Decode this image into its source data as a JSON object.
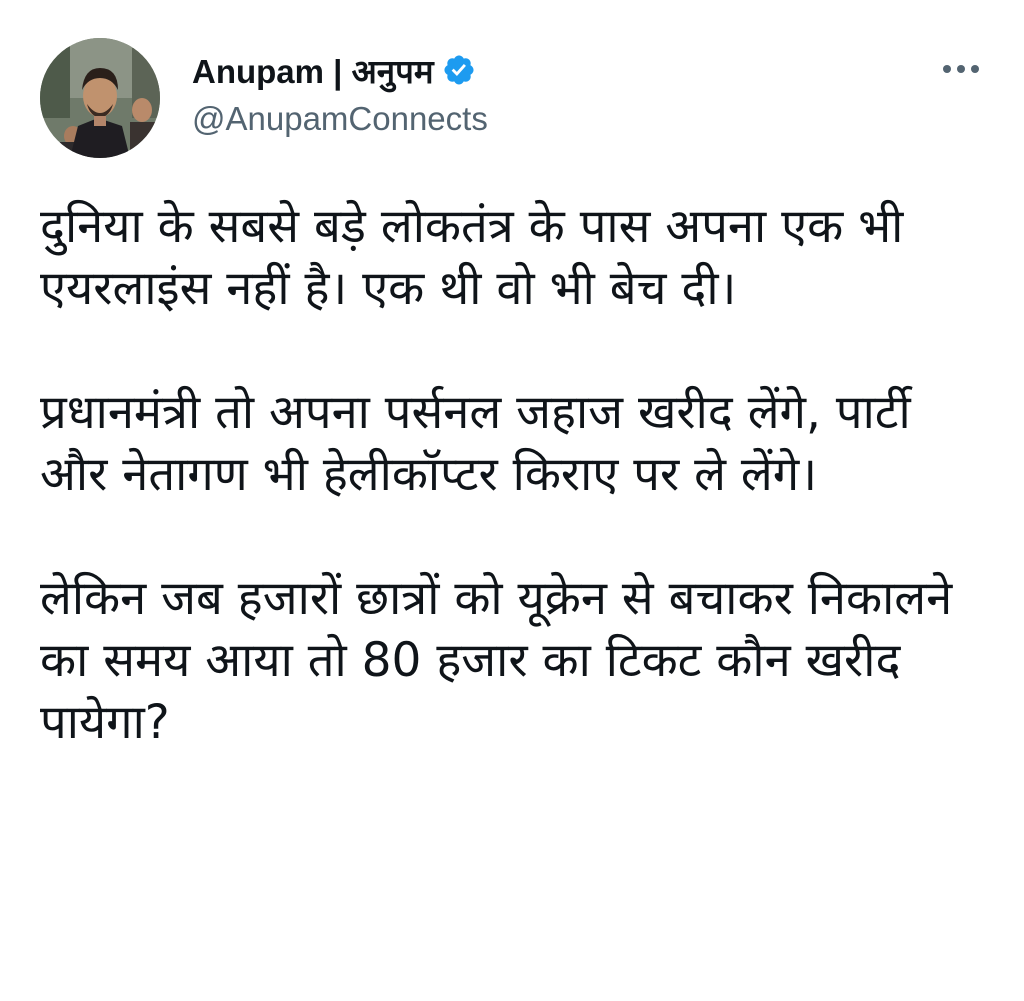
{
  "author": {
    "display_name": "Anupam | अनुपम",
    "handle": "@AnupamConnects",
    "verified": true,
    "avatar_icon": "profile-photo"
  },
  "more_icon": "more-options-icon",
  "tweet": {
    "paragraphs": [
      "दुनिया के सबसे बड़े लोकतंत्र के पास अपना एक भी एयरलाइंस नहीं है। एक थी वो भी बेच दी।",
      "प्रधानमंत्री तो अपना पर्सनल जहाज खरीद लेंगे, पार्टी और नेतागण भी हेलीकॉप्टर किराए पर ले लेंगे।",
      "लेकिन जब हजारों छात्रों को यूक्रेन से बचाकर निकालने का समय आया तो 80 हजार का टिकट कौन खरीद पायेगा?"
    ]
  },
  "colors": {
    "text": "#0f1419",
    "secondary": "#536471",
    "verified_blue": "#1d9bf0"
  }
}
